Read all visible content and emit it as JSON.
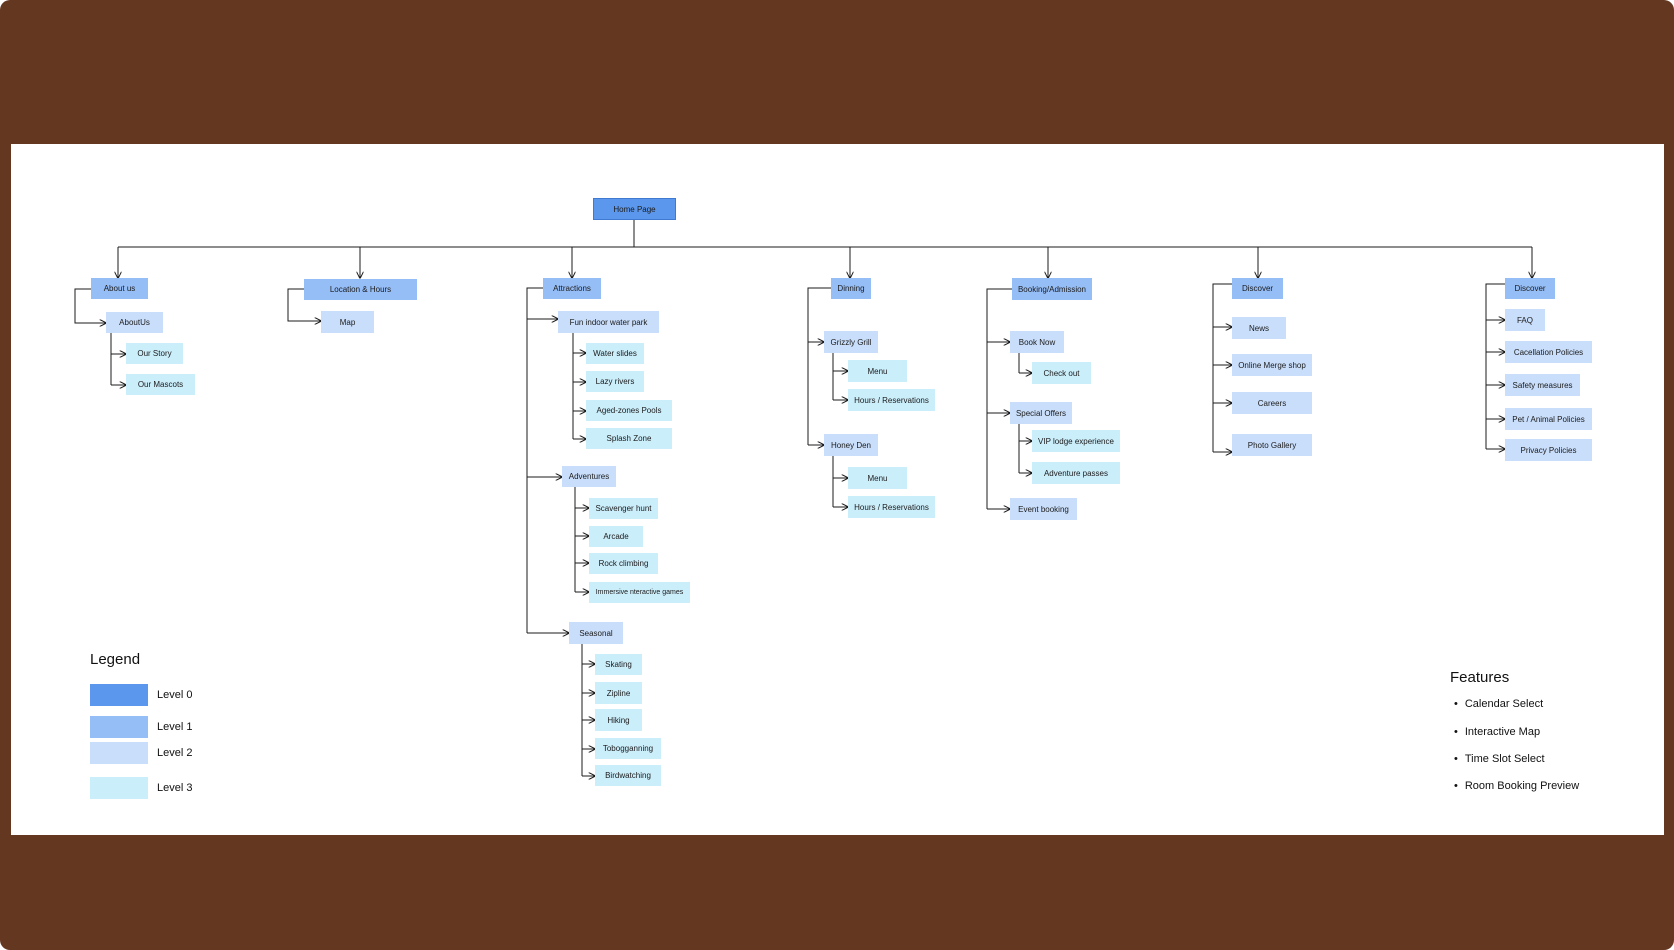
{
  "colors": {
    "level0": "#5b97ec",
    "level1": "#95bdf6",
    "level2": "#c9defb",
    "level3": "#cbeefb",
    "frame": "#643721",
    "line": "#1b1b1b"
  },
  "root": {
    "label": "Home Page"
  },
  "sections": [
    {
      "label": "About us",
      "children": [
        {
          "label": "AboutUs",
          "children": [
            {
              "label": "Our Story"
            },
            {
              "label": "Our Mascots"
            }
          ]
        }
      ]
    },
    {
      "label": "Location & Hours",
      "children": [
        {
          "label": "Map"
        }
      ]
    },
    {
      "label": "Attractions",
      "children": [
        {
          "label": "Fun indoor water park",
          "children": [
            {
              "label": "Water slides"
            },
            {
              "label": "Lazy rivers"
            },
            {
              "label": "Aged-zones Pools"
            },
            {
              "label": "Splash Zone"
            }
          ]
        },
        {
          "label": "Adventures",
          "children": [
            {
              "label": "Scavenger hunt"
            },
            {
              "label": "Arcade"
            },
            {
              "label": "Rock climbing"
            },
            {
              "label": "Immersive nteractive games"
            }
          ]
        },
        {
          "label": "Seasonal",
          "children": [
            {
              "label": "Skating"
            },
            {
              "label": "Zipline"
            },
            {
              "label": "Hiking"
            },
            {
              "label": "Tobogganning"
            },
            {
              "label": "Birdwatching"
            }
          ]
        }
      ]
    },
    {
      "label": "Dinning",
      "children": [
        {
          "label": "Grizzly Grill",
          "children": [
            {
              "label": "Menu"
            },
            {
              "label": "Hours / Reservations"
            }
          ]
        },
        {
          "label": "Honey Den",
          "children": [
            {
              "label": "Menu"
            },
            {
              "label": "Hours / Reservations"
            }
          ]
        }
      ]
    },
    {
      "label": "Booking/Admission",
      "children": [
        {
          "label": "Book Now",
          "children": [
            {
              "label": "Check out"
            }
          ]
        },
        {
          "label": "Special Offers",
          "children": [
            {
              "label": "VIP lodge experience"
            },
            {
              "label": "Adventure passes"
            }
          ]
        },
        {
          "label": "Event booking"
        }
      ]
    },
    {
      "label": "Discover",
      "children": [
        {
          "label": "News"
        },
        {
          "label": "Online Merge shop"
        },
        {
          "label": "Careers"
        },
        {
          "label": "Photo Gallery"
        }
      ]
    },
    {
      "label": "Discover",
      "children": [
        {
          "label": "FAQ"
        },
        {
          "label": "Cacellation  Policies"
        },
        {
          "label": "Safety measures"
        },
        {
          "label": "Pet / Animal Policies"
        },
        {
          "label": "Privacy Policies"
        }
      ]
    }
  ],
  "legend": {
    "title": "Legend",
    "items": [
      {
        "label": "Level 0"
      },
      {
        "label": "Level 1"
      },
      {
        "label": "Level 2"
      },
      {
        "label": "Level 3"
      }
    ]
  },
  "features": {
    "title": "Features",
    "items": [
      "Calendar Select",
      "Interactive Map",
      "Time Slot Select",
      "Room Booking Preview"
    ]
  }
}
